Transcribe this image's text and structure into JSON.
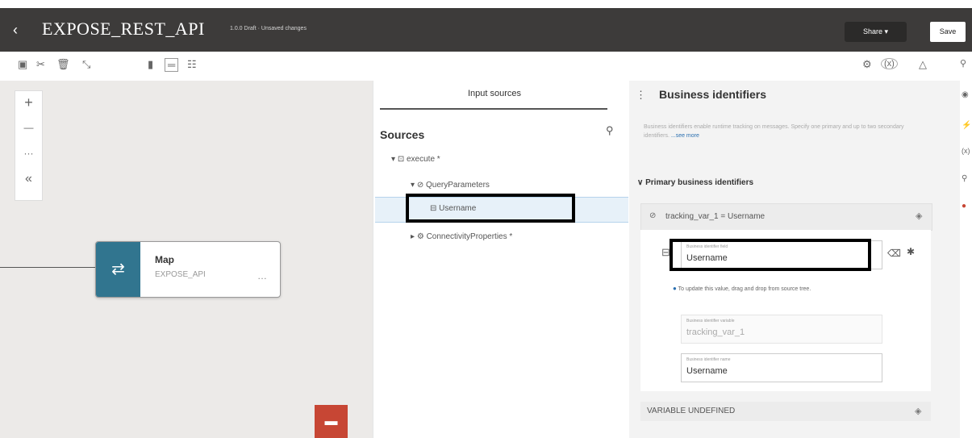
{
  "header": {
    "back_glyph": "‹",
    "title": "EXPOSE_REST_API",
    "status": "1.0.0 Draft · Unsaved changes",
    "share_label": "Share ▾",
    "save_label": "Save"
  },
  "toolbar": {
    "left_icons": [
      "save-icon",
      "cut-icon",
      "delete-icon",
      "expand-icon",
      "vertical-layout-icon",
      "horizontal-layout-icon",
      "tree-layout-icon"
    ],
    "right_icons": [
      "settings-icon",
      "variables-icon",
      "warning-icon",
      "user-icon"
    ]
  },
  "canvas": {
    "zoom_in": "+",
    "zoom_out": "—",
    "more": "···",
    "collapse": "«",
    "node": {
      "title": "Map",
      "subtitle": "EXPOSE_API",
      "more": "…",
      "accent": "#31758f"
    },
    "chat_accent": "#c74634"
  },
  "sources": {
    "tab_label": "Input sources",
    "heading": "Sources",
    "tree": {
      "execute": "execute *",
      "query_parameters": "QueryParameters",
      "username": "Username",
      "connectivity": "ConnectivityProperties *"
    }
  },
  "business": {
    "title": "Business identifiers",
    "description": "Business identifiers enable runtime tracking on messages. Specify one primary and up to two secondary identifiers. ",
    "see_more": "...see more",
    "primary_heading": "Primary business identifiers",
    "tracking_row": "tracking_var_1 = Username",
    "field_label_1": "Business identifier field",
    "field_value_1": "Username",
    "note": "To update this value, drag and drop from source tree.",
    "field_label_2": "Business identifier variable",
    "field_value_2": "tracking_var_1",
    "field_label_3": "Business identifier name",
    "field_value_3": "Username",
    "variable_undefined": "VARIABLE UNDEFINED"
  }
}
